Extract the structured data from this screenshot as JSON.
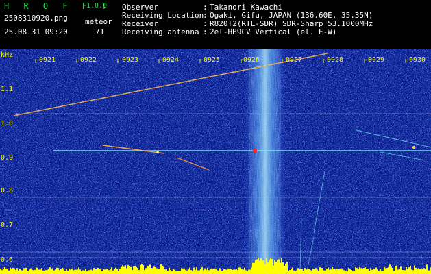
{
  "header": {
    "app_title": "H R O F F T",
    "app_version": "1.0.0",
    "filename": "2508310920.png",
    "detection_label": "meteor",
    "timestamp": "25.08.31 09:20",
    "detection_count": "71"
  },
  "info": [
    {
      "label": "Observer",
      "value": "Takanori Kawachi"
    },
    {
      "label": "Receiving Location",
      "value": "Ogaki, Gifu, JAPAN (136.60E, 35.35N)"
    },
    {
      "label": "Receiver",
      "value": "R820T2(RTL-SDR) SDR-Sharp 53.1000MHz"
    },
    {
      "label": "Receiving antenna",
      "value": "2el-HB9CV Vertical (el. E-W)"
    }
  ],
  "spectrogram": {
    "y_axis_unit": "kHz",
    "y_ticks": [
      "1.1",
      "1.0",
      "0.9",
      "0.8",
      "0.7",
      "0.6"
    ],
    "x_ticks": [
      "0921",
      "0922",
      "0923",
      "0924",
      "0925",
      "0926",
      "0927",
      "0928",
      "0929",
      "0930"
    ],
    "colors": {
      "background": "#0a1c8c",
      "noise": "#3550d8",
      "carrier": "#7ef0ff",
      "signal_hot": "#ff2020",
      "baseline": "#ffff00",
      "grid": "#c8d0ff"
    }
  }
}
